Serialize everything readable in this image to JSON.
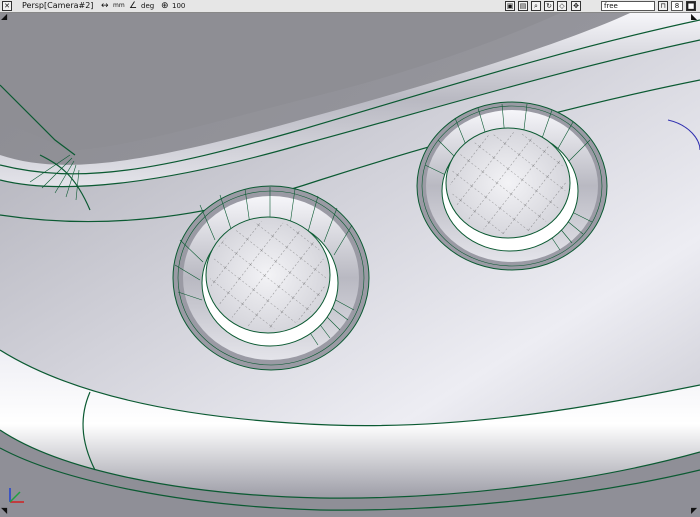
{
  "toolbar": {
    "view_label": "Persp[Camera#2]",
    "length_unit": "mm",
    "angle_unit": "deg",
    "scale_value": "100",
    "mode_value": "free",
    "number_value": "8",
    "icons": [
      "close-icon",
      "length-unit-icon",
      "angle-unit-icon",
      "scale-icon",
      "render-icon",
      "save-view-icon",
      "zoom-icon",
      "rotate-icon",
      "fit-icon",
      "pan-icon",
      "layout-icon",
      "maximize-icon"
    ]
  },
  "viewport": {
    "description_colors": {
      "background": "#9a9aa0",
      "edge_lines": "#0b5a32",
      "axis_x": "#d02020",
      "axis_y": "#20a040",
      "axis_z": "#2040d0"
    }
  }
}
